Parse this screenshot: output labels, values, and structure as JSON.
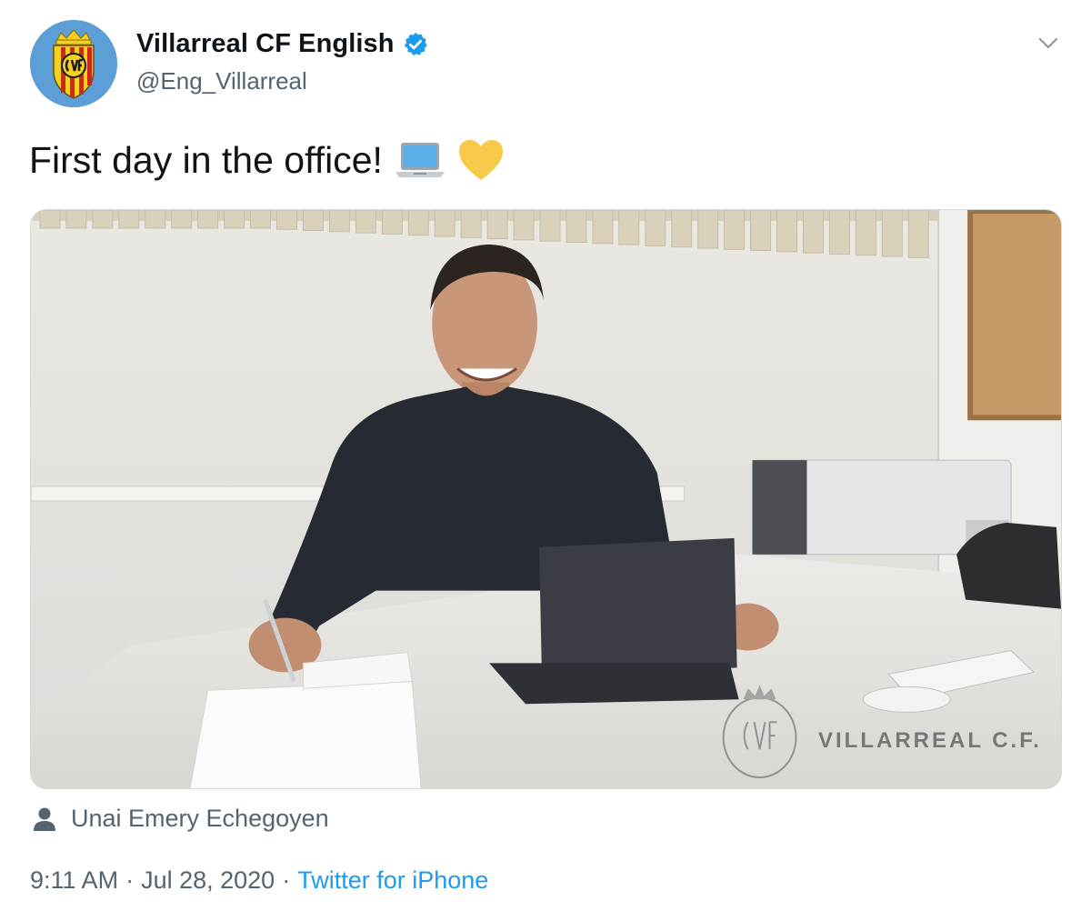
{
  "author": {
    "display_name": "Villarreal CF English",
    "handle": "@Eng_Villarreal",
    "verified_icon": "verified-badge-icon",
    "avatar_icon": "villarreal-crest-icon"
  },
  "menu": {
    "icon": "chevron-down-icon"
  },
  "tweet": {
    "text": "First day in the office!",
    "emojis": [
      "laptop-emoji",
      "yellow-heart-emoji"
    ]
  },
  "photo": {
    "watermark_text": "VILLARREAL C.F."
  },
  "tagged": {
    "icon": "person-icon",
    "name": "Unai Emery Echegoyen"
  },
  "meta": {
    "time": "9:11 AM",
    "separator": "·",
    "date": "Jul 28, 2020",
    "source": "Twitter for iPhone"
  },
  "colors": {
    "link": "#1d9bf0",
    "secondary_text": "#536471",
    "avatar_bg": "#5b9fd6",
    "crest_yellow": "#f5d020",
    "crest_red": "#d0271d"
  }
}
